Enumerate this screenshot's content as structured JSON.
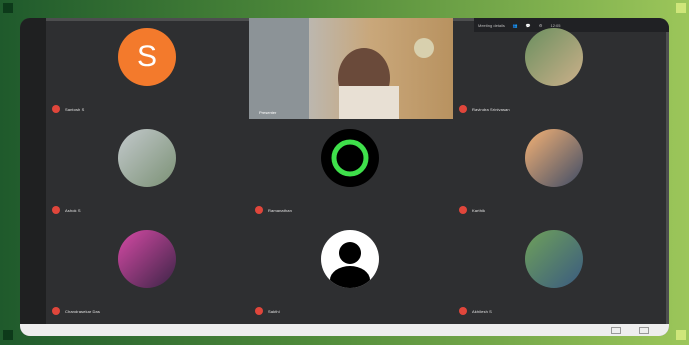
{
  "meeting": {
    "topbar_info": "Meeting details",
    "topbar_time": "12:05",
    "tiles": [
      {
        "name": "Santosh S",
        "avatar": "letter",
        "letter": "S"
      },
      {
        "name": "Presenter",
        "avatar": "video"
      },
      {
        "name": "Ravindra Srinivasan",
        "avatar": "photo"
      },
      {
        "name": "Ashok S",
        "avatar": "photo"
      },
      {
        "name": "Ramanathan",
        "avatar": "ring"
      },
      {
        "name": "Karthik",
        "avatar": "photo"
      },
      {
        "name": "Chandrasekar Das",
        "avatar": "photo"
      },
      {
        "name": "Sakthi",
        "avatar": "silhouette"
      },
      {
        "name": "Akhilesh S",
        "avatar": "photo"
      }
    ]
  },
  "colors": {
    "meeting_bg": "#2e2f31",
    "accent_orange": "#f37a2c",
    "mic_off_red": "#e0463b",
    "ring_green": "#3fe04b"
  }
}
